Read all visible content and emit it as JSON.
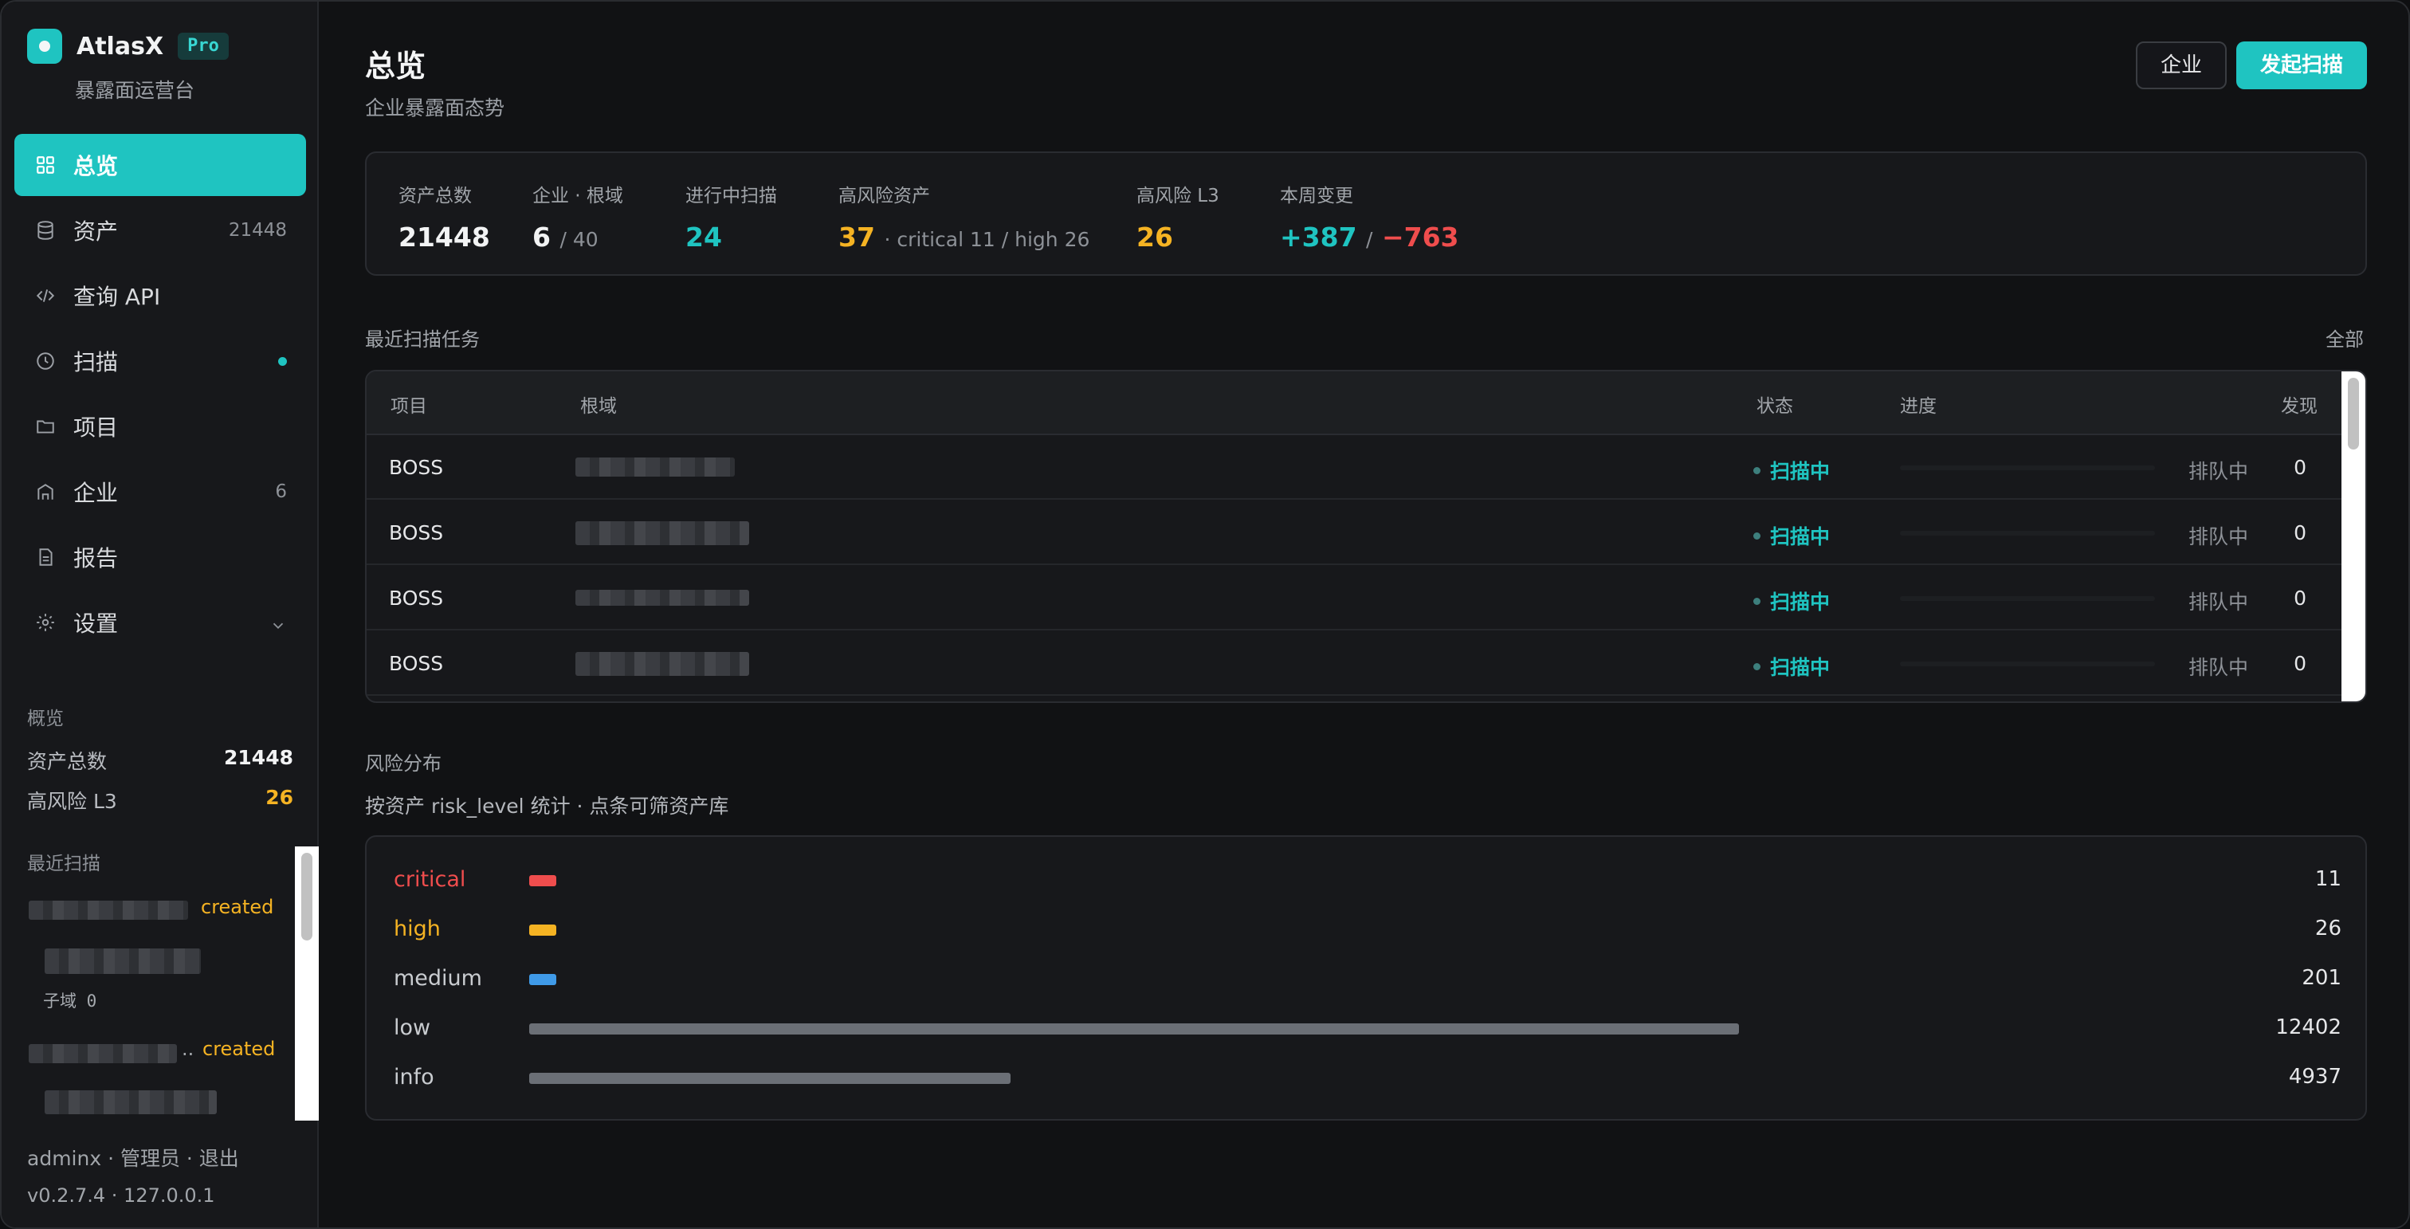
{
  "brand": {
    "name": "AtlasX",
    "badge": "Pro",
    "subtitle": "暴露面运营台"
  },
  "nav": [
    {
      "label": "总览",
      "icon": "grid-icon",
      "active": true
    },
    {
      "label": "资产",
      "icon": "database-icon",
      "count": "21448"
    },
    {
      "label": "查询 API",
      "icon": "code-icon"
    },
    {
      "label": "扫描",
      "icon": "clock-icon",
      "dot": true
    },
    {
      "label": "项目",
      "icon": "folder-icon"
    },
    {
      "label": "企业",
      "icon": "building-icon",
      "count": "6"
    },
    {
      "label": "报告",
      "icon": "document-icon"
    },
    {
      "label": "设置",
      "icon": "gear-icon",
      "chevron": "chevron-down-icon"
    }
  ],
  "sidebar_overview": {
    "title": "概览",
    "assets_label": "资产总数",
    "assets_value": "21448",
    "risk_label": "高风险 L3",
    "risk_value": "26"
  },
  "recent_scans": {
    "title": "最近扫描",
    "items": [
      {
        "status": "created",
        "sub": "子域 0"
      },
      {
        "status": "created",
        "ellipsis": ".."
      }
    ]
  },
  "footer": {
    "user_line": "adminx · 管理员 · 退出",
    "version_line": "v0.2.7.4 · 127.0.0.1"
  },
  "header": {
    "title": "总览",
    "subtitle": "企业暴露面态势",
    "btn_enterprise": "企业",
    "btn_scan": "发起扫描"
  },
  "stats": {
    "total_assets": {
      "label": "资产总数",
      "value": "21448"
    },
    "enterprise_root": {
      "label": "企业 · 根域",
      "value": "6",
      "suffix": "/ 40"
    },
    "running_scans": {
      "label": "进行中扫描",
      "value": "24"
    },
    "high_risk_assets": {
      "label": "高风险资产",
      "value": "37",
      "suffix": "· critical 11 / high 26"
    },
    "high_risk_l3": {
      "label": "高风险 L3",
      "value": "26"
    },
    "weekly_change": {
      "label": "本周变更",
      "plus": "+387",
      "sep": "/",
      "minus": "−763"
    }
  },
  "recent_tasks": {
    "title": "最近扫描任务",
    "link": "全部",
    "columns": [
      "项目",
      "根域",
      "状态",
      "进度",
      "发现"
    ],
    "rows": [
      {
        "project": "BOSS",
        "status": "扫描中",
        "progress": "排队中",
        "found": "0"
      },
      {
        "project": "BOSS",
        "status": "扫描中",
        "progress": "排队中",
        "found": "0"
      },
      {
        "project": "BOSS",
        "status": "扫描中",
        "progress": "排队中",
        "found": "0"
      },
      {
        "project": "BOSS",
        "status": "扫描中",
        "progress": "排队中",
        "found": "0"
      }
    ]
  },
  "risk": {
    "title": "风险分布",
    "subtitle": "按资产 risk_level 统计 · 点条可筛资产库",
    "levels": [
      {
        "name": "critical",
        "count": "11",
        "value": 11,
        "color": "#ef4d4d"
      },
      {
        "name": "high",
        "count": "26",
        "value": 26,
        "color": "#f5b323"
      },
      {
        "name": "medium",
        "count": "201",
        "value": 201,
        "color": "#3f9ae8"
      },
      {
        "name": "low",
        "count": "12402",
        "value": 12402,
        "color": "#6b6f76"
      },
      {
        "name": "info",
        "count": "4937",
        "value": 4937,
        "color": "#6b6f76"
      }
    ]
  }
}
